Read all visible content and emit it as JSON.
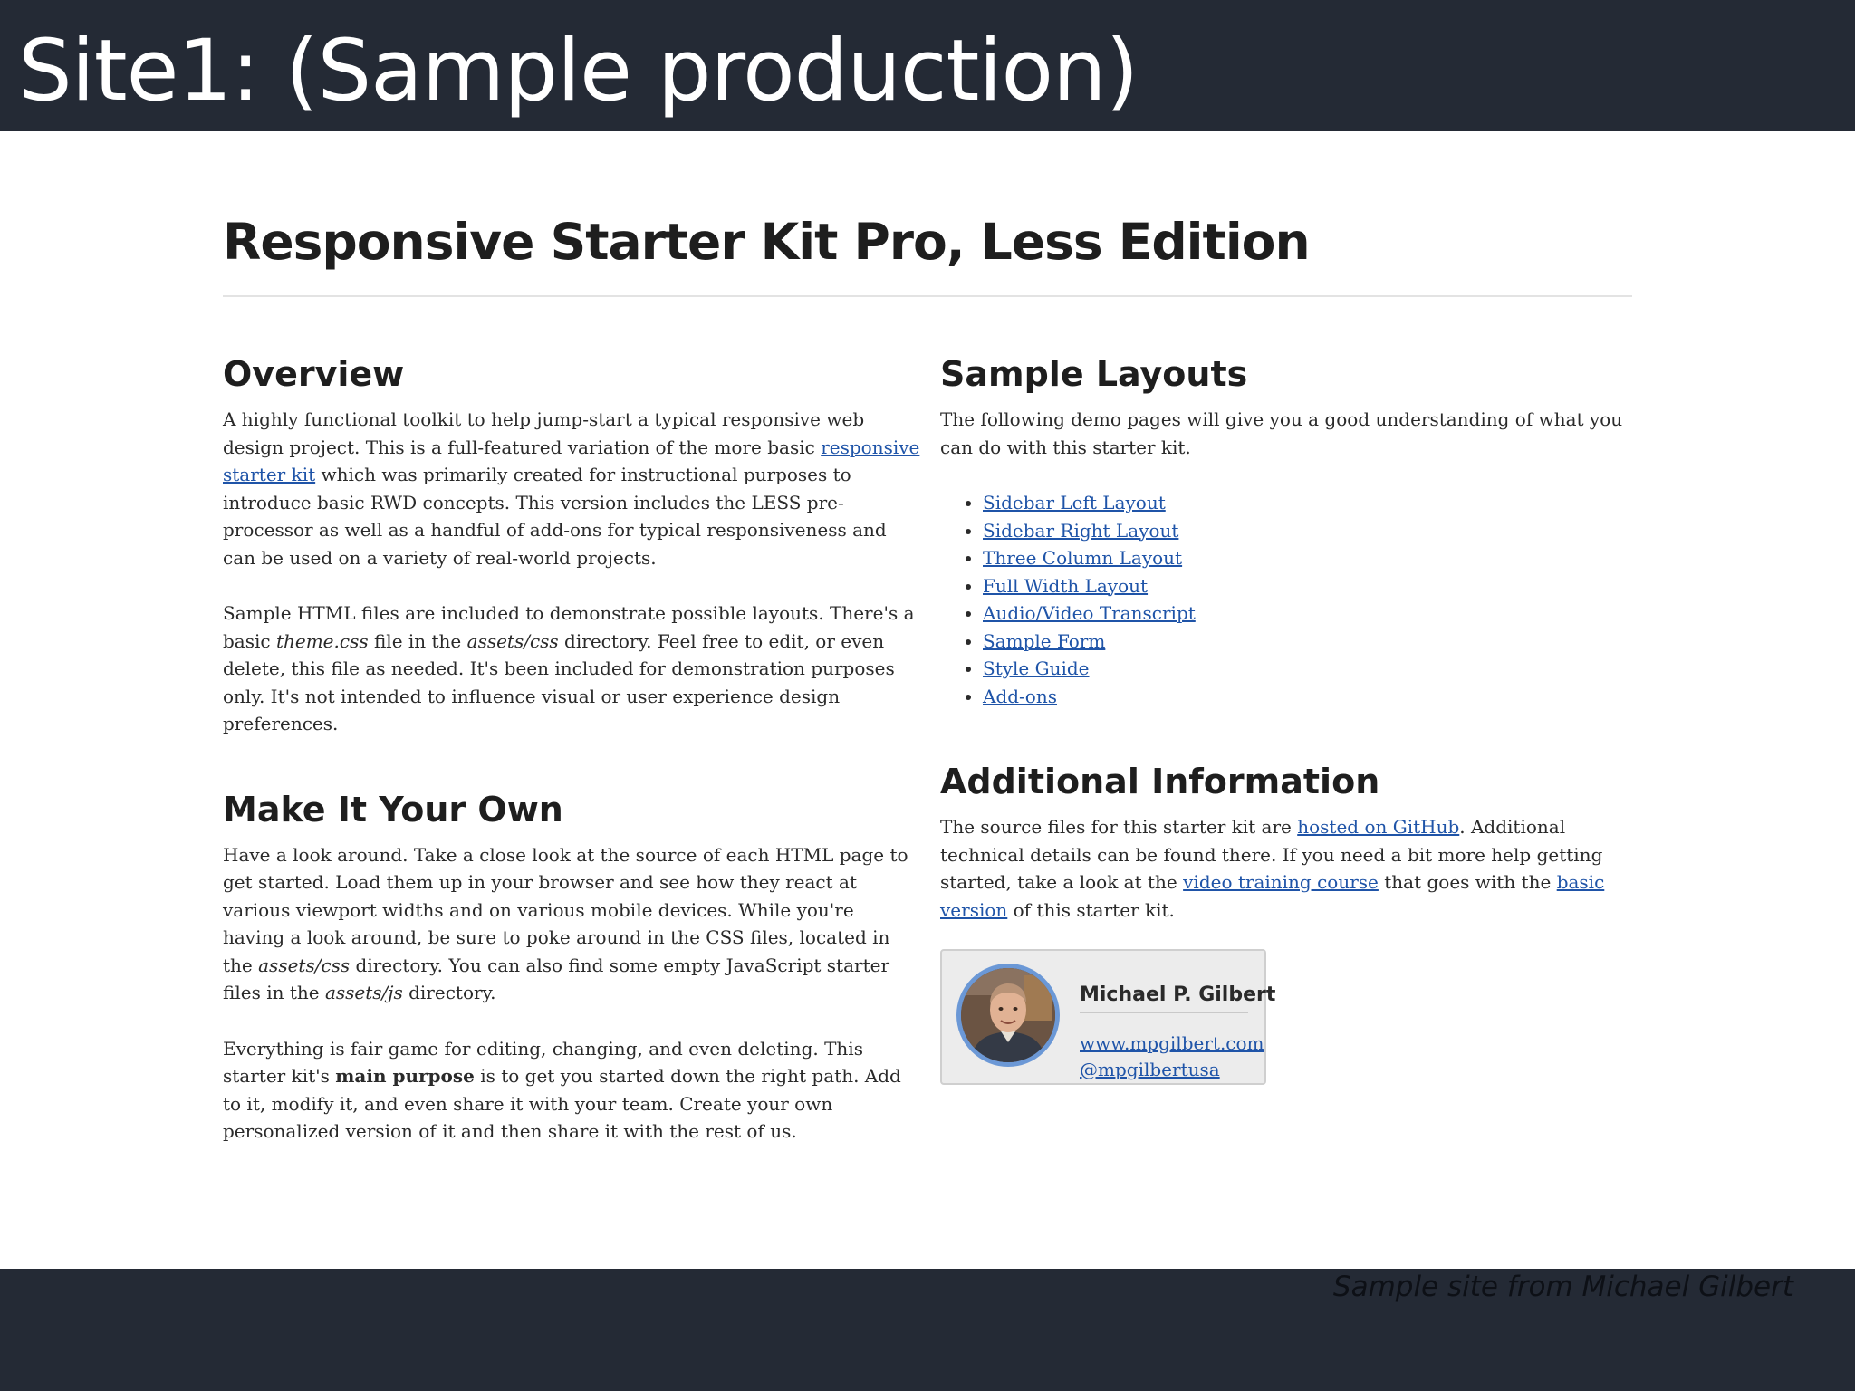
{
  "slide": {
    "title": "Site1: (Sample production)",
    "credit": "Sample site from Michael Gilbert"
  },
  "page": {
    "heading": "Responsive Starter Kit Pro, Less Edition"
  },
  "overview": {
    "title": "Overview",
    "p1_before": "A highly functional toolkit to help jump-start a typical responsive web design project. This is a full-featured variation of the more basic ",
    "p1_link": "responsive starter kit",
    "p1_after": " which was primarily created for instructional purposes to introduce basic RWD concepts. This version includes the LESS pre-processor as well as a handful of add-ons for typical responsiveness and can be used on a variety of real-world projects.",
    "p2_before": "Sample HTML files are included to demonstrate possible layouts. There's a basic ",
    "p2_em1": "theme.css",
    "p2_mid": " file in the ",
    "p2_em2": "assets/css",
    "p2_after": " directory. Feel free to edit, or even delete, this file as needed. It's been included for demonstration purposes only. It's not intended to influence visual or user experience design preferences."
  },
  "make_own": {
    "title": "Make It Your Own",
    "p1_before": "Have a look around. Take a close look at the source of each HTML page to get started. Load them up in your browser and see how they react at various viewport widths and on various mobile devices. While you're having a look around, be sure to poke around in the CSS files, located in the ",
    "p1_em1": "assets/css",
    "p1_mid": " directory. You can also find some empty JavaScript starter files in the ",
    "p1_em2": "assets/js",
    "p1_after": " directory.",
    "p2_before": "Everything is fair game for editing, changing, and even deleting. This starter kit's ",
    "p2_strong": "main purpose",
    "p2_after": " is to get you started down the right path. Add to it, modify it, and even share it with your team. Create your own personalized version of it and then share it with the rest of us."
  },
  "sample_layouts": {
    "title": "Sample Layouts",
    "intro": "The following demo pages will give you a good understanding of what you can do with this starter kit.",
    "links": [
      "Sidebar Left Layout",
      "Sidebar Right Layout",
      "Three Column Layout",
      "Full Width Layout",
      "Audio/Video Transcript",
      "Sample Form",
      "Style Guide",
      "Add-ons"
    ]
  },
  "additional": {
    "title": "Additional Information",
    "t1": "The source files for this starter kit are ",
    "link1": "hosted on GitHub",
    "t2": ". Additional technical details can be found there. If you need a bit more help getting started, take a look at the ",
    "link2": "video training course",
    "t3": " that goes with the ",
    "link3": "basic version",
    "t4": " of this starter kit."
  },
  "profile": {
    "name": "Michael P. Gilbert",
    "website": "www.mpgilbert.com",
    "handle": "@mpgilbertusa",
    "avatar_icon": "person-photo-icon"
  },
  "colors": {
    "bar": "#242a35",
    "link": "#1f54a8",
    "avatar_ring": "#6b98d6"
  }
}
